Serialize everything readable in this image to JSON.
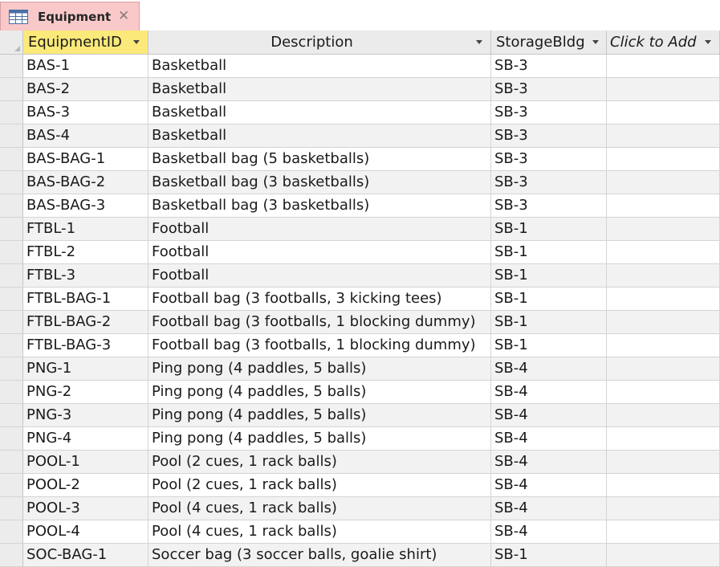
{
  "tab": {
    "title": "Equipment",
    "close_glyph": "✕",
    "icon": "table-icon"
  },
  "columns": [
    {
      "label": "EquipmentID",
      "highlight": true
    },
    {
      "label": "Description",
      "highlight": false
    },
    {
      "label": "StorageBldg",
      "highlight": false
    },
    {
      "label": "Click to Add",
      "highlight": false,
      "italic": true
    }
  ],
  "rows": [
    [
      "BAS-1",
      "Basketball",
      "SB-3",
      ""
    ],
    [
      "BAS-2",
      "Basketball",
      "SB-3",
      ""
    ],
    [
      "BAS-3",
      "Basketball",
      "SB-3",
      ""
    ],
    [
      "BAS-4",
      "Basketball",
      "SB-3",
      ""
    ],
    [
      "BAS-BAG-1",
      "Basketball bag (5 basketballs)",
      "SB-3",
      ""
    ],
    [
      "BAS-BAG-2",
      "Basketball bag (3 basketballs)",
      "SB-3",
      ""
    ],
    [
      "BAS-BAG-3",
      "Basketball bag (3 basketballs)",
      "SB-3",
      ""
    ],
    [
      "FTBL-1",
      "Football",
      "SB-1",
      ""
    ],
    [
      "FTBL-2",
      "Football",
      "SB-1",
      ""
    ],
    [
      "FTBL-3",
      "Football",
      "SB-1",
      ""
    ],
    [
      "FTBL-BAG-1",
      "Football bag (3 footballs, 3 kicking tees)",
      "SB-1",
      ""
    ],
    [
      "FTBL-BAG-2",
      "Football bag (3 footballs, 1 blocking dummy)",
      "SB-1",
      ""
    ],
    [
      "FTBL-BAG-3",
      "Football bag (3 footballs, 1 blocking dummy)",
      "SB-1",
      ""
    ],
    [
      "PNG-1",
      "Ping pong (4 paddles, 5 balls)",
      "SB-4",
      ""
    ],
    [
      "PNG-2",
      "Ping pong (4 paddles, 5 balls)",
      "SB-4",
      ""
    ],
    [
      "PNG-3",
      "Ping pong (4 paddles, 5 balls)",
      "SB-4",
      ""
    ],
    [
      "PNG-4",
      "Ping pong (4 paddles, 5 balls)",
      "SB-4",
      ""
    ],
    [
      "POOL-1",
      "Pool (2 cues, 1 rack balls)",
      "SB-4",
      ""
    ],
    [
      "POOL-2",
      "Pool (2 cues, 1 rack balls)",
      "SB-4",
      ""
    ],
    [
      "POOL-3",
      "Pool (4 cues, 1 rack balls)",
      "SB-4",
      ""
    ],
    [
      "POOL-4",
      "Pool (4 cues, 1 rack balls)",
      "SB-4",
      ""
    ],
    [
      "SOC-BAG-1",
      "Soccer bag (3 soccer balls, goalie shirt)",
      "SB-1",
      ""
    ]
  ],
  "colors": {
    "tab_bg": "#f9c9c9",
    "header_bg": "#ebebeb",
    "header_highlight": "#fbe97a",
    "row_alt": "#f2f2f2",
    "gridline": "#d4d4d4"
  }
}
